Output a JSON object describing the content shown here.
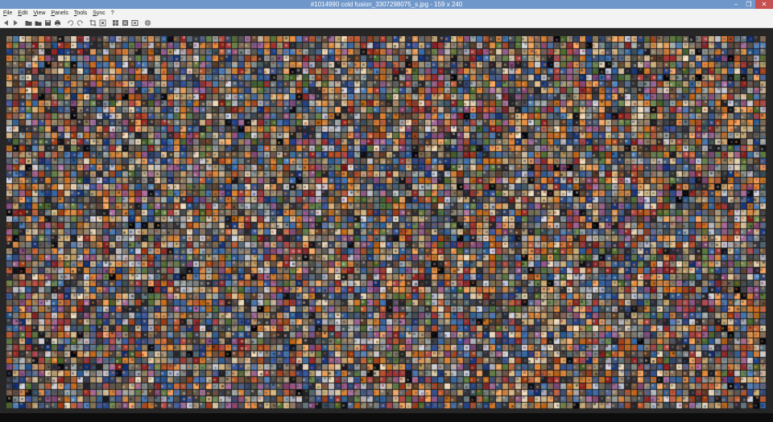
{
  "window": {
    "title": "#1014990 cold fusion_3307298075_s.jpg  -  159 x 240",
    "controls": {
      "minimize": "–",
      "maximize": "❐",
      "close": "✕"
    }
  },
  "menu": {
    "items": [
      {
        "label": "File"
      },
      {
        "label": "Edit"
      },
      {
        "label": "View"
      },
      {
        "label": "Panels"
      },
      {
        "label": "Tools"
      },
      {
        "label": "Sync"
      },
      {
        "label": "?"
      }
    ]
  },
  "toolbar": {
    "icons": [
      "back-icon",
      "forward-icon",
      "open-folder-icon",
      "folder-icon",
      "save-icon",
      "print-icon",
      "rotate-left-icon",
      "rotate-right-icon",
      "crop-icon",
      "resize-icon",
      "grid-icon",
      "fit-icon",
      "thumbnail-icon",
      "globe-icon"
    ]
  },
  "viewer": {
    "content": "photo-mosaic-image",
    "colors": {
      "background": "#262626",
      "titlebar": "#6f97c9",
      "close_button": "#c75050"
    }
  }
}
